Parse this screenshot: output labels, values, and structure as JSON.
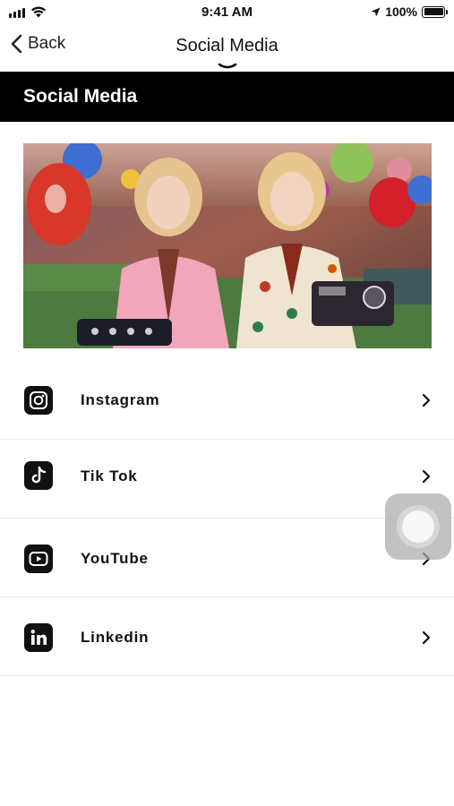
{
  "status_bar": {
    "time": "9:41 AM",
    "battery": "100%",
    "icons": [
      "signal-icon",
      "wifi-icon",
      "location-arrow-icon",
      "battery-icon"
    ]
  },
  "nav": {
    "back_label": "Back",
    "title": "Social Media"
  },
  "header": {
    "title": "Social Media"
  },
  "banner": {
    "description_icon": "banner-image"
  },
  "items": [
    {
      "label": "Instagram",
      "icon": "instagram-icon"
    },
    {
      "label": "Tik Tok",
      "icon": "tiktok-icon"
    },
    {
      "label": "YouTube",
      "icon": "youtube-icon"
    },
    {
      "label": "Linkedin",
      "icon": "linkedin-icon"
    }
  ],
  "colors": {
    "header_bg": "#000000",
    "header_text": "#ffffff",
    "divider": "#ececec"
  }
}
